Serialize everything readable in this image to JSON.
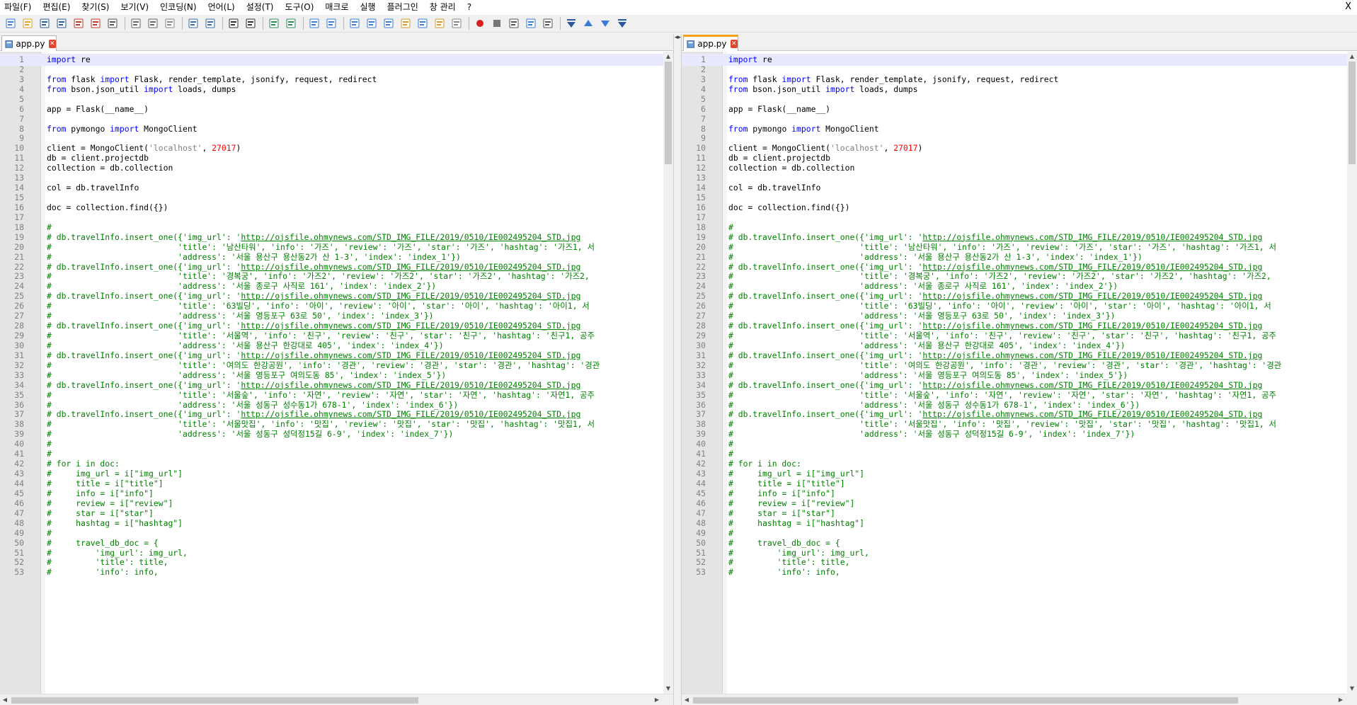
{
  "menu": {
    "items": [
      "파일(F)",
      "편집(E)",
      "찾기(S)",
      "보기(V)",
      "인코딩(N)",
      "언어(L)",
      "설정(T)",
      "도구(O)",
      "매크로",
      "실행",
      "플러그인",
      "창 관리",
      "?"
    ],
    "close_label": "X"
  },
  "toolbar": {
    "icons": [
      "new-file-icon",
      "open-file-icon",
      "save-icon",
      "save-all-icon",
      "close-icon",
      "close-all-icon",
      "print-icon",
      "cut-icon",
      "copy-icon",
      "paste-icon",
      "undo-icon",
      "redo-icon",
      "find-icon",
      "replace-icon",
      "zoom-in-icon",
      "zoom-out-icon",
      "sync-vertical-icon",
      "sync-horizontal-icon",
      "word-wrap-icon",
      "show-all-chars-icon",
      "indent-guide-icon",
      "function-list-icon",
      "doc-map-icon",
      "folder-workspace-icon",
      "monitoring-icon",
      "record-macro-icon",
      "stop-macro-icon",
      "play-macro-icon",
      "run-macro-multiple-icon",
      "save-macro-icon",
      "compare-first-icon",
      "compare-prev-icon",
      "compare-next-icon",
      "compare-last-icon"
    ]
  },
  "colors": {
    "keyword": "#0000ff",
    "comment": "#008000",
    "number": "#ff0000",
    "string": "#808080",
    "active_tab_accent": "#f8a01a"
  },
  "left_pane": {
    "tab_label": "app.py"
  },
  "right_pane": {
    "tab_label": "app.py"
  },
  "lines": [
    {
      "n": "1",
      "t": [
        [
          "kw",
          "import"
        ],
        [
          "",
          " re"
        ]
      ]
    },
    {
      "n": "2",
      "t": []
    },
    {
      "n": "3",
      "t": [
        [
          "kw",
          "from"
        ],
        [
          "",
          " flask "
        ],
        [
          "kw",
          "import"
        ],
        [
          "",
          " Flask, render_template, jsonify, request, redirect"
        ]
      ]
    },
    {
      "n": "4",
      "t": [
        [
          "kw",
          "from"
        ],
        [
          "",
          " bson.json_util "
        ],
        [
          "kw",
          "import"
        ],
        [
          "",
          " loads, dumps"
        ]
      ]
    },
    {
      "n": "5",
      "t": []
    },
    {
      "n": "6",
      "t": [
        [
          "",
          "app = Flask(__name__)"
        ]
      ]
    },
    {
      "n": "7",
      "t": []
    },
    {
      "n": "8",
      "t": [
        [
          "kw",
          "from"
        ],
        [
          "",
          " pymongo "
        ],
        [
          "kw",
          "import"
        ],
        [
          "",
          " MongoClient"
        ]
      ]
    },
    {
      "n": "9",
      "t": []
    },
    {
      "n": "10",
      "t": [
        [
          "",
          "client = MongoClient("
        ],
        [
          "str",
          "'localhost'"
        ],
        [
          "",
          ", "
        ],
        [
          "num",
          "27017"
        ],
        [
          "",
          ")"
        ]
      ]
    },
    {
      "n": "11",
      "t": [
        [
          "",
          "db = client.projectdb"
        ]
      ]
    },
    {
      "n": "12",
      "t": [
        [
          "",
          "collection = db.collection"
        ]
      ]
    },
    {
      "n": "13",
      "t": []
    },
    {
      "n": "14",
      "t": [
        [
          "",
          "col = db.travelInfo"
        ]
      ]
    },
    {
      "n": "15",
      "t": []
    },
    {
      "n": "16",
      "t": [
        [
          "",
          "doc = collection.find({})"
        ]
      ]
    },
    {
      "n": "17",
      "t": []
    },
    {
      "n": "18",
      "t": [
        [
          "cm",
          "#"
        ]
      ]
    },
    {
      "n": "19",
      "t": [
        [
          "cm",
          "# db.travelInfo.insert_one({'img_url': '"
        ],
        [
          "cm-url",
          "http://ojsfile.ohmynews.com/STD_IMG_FILE/2019/0510/IE002495204_STD.jpg"
        ]
      ]
    },
    {
      "n": "20",
      "t": [
        [
          "cm",
          "#                          'title': '남산타워', 'info': '가즈', 'review': '가즈', 'star': '가즈', 'hashtag': '가즈1, 서"
        ]
      ]
    },
    {
      "n": "21",
      "t": [
        [
          "cm",
          "#                          'address': '서울 용산구 용산동2가 산 1-3', 'index': 'index_1'})"
        ]
      ]
    },
    {
      "n": "22",
      "t": [
        [
          "cm",
          "# db.travelInfo.insert_one({'img_url': '"
        ],
        [
          "cm-url",
          "http://ojsfile.ohmynews.com/STD_IMG_FILE/2019/0510/IE002495204_STD.jpg"
        ]
      ]
    },
    {
      "n": "23",
      "t": [
        [
          "cm",
          "#                          'title': '경복궁', 'info': '가즈2', 'review': '가즈2', 'star': '가즈2', 'hashtag': '가즈2,"
        ]
      ]
    },
    {
      "n": "24",
      "t": [
        [
          "cm",
          "#                          'address': '서울 종로구 사직로 161', 'index': 'index_2'})"
        ]
      ]
    },
    {
      "n": "25",
      "t": [
        [
          "cm",
          "# db.travelInfo.insert_one({'img_url': '"
        ],
        [
          "cm-url",
          "http://ojsfile.ohmynews.com/STD_IMG_FILE/2019/0510/IE002495204_STD.jpg"
        ]
      ]
    },
    {
      "n": "26",
      "t": [
        [
          "cm",
          "#                          'title': '63빌딩', 'info': '아이', 'review': '아이', 'star': '아이', 'hashtag': '아이1, 서"
        ]
      ]
    },
    {
      "n": "27",
      "t": [
        [
          "cm",
          "#                          'address': '서울 영등포구 63로 50', 'index': 'index_3'})"
        ]
      ]
    },
    {
      "n": "28",
      "t": [
        [
          "cm",
          "# db.travelInfo.insert_one({'img_url': '"
        ],
        [
          "cm-url",
          "http://ojsfile.ohmynews.com/STD_IMG_FILE/2019/0510/IE002495204_STD.jpg"
        ]
      ]
    },
    {
      "n": "29",
      "t": [
        [
          "cm",
          "#                          'title': '서울역', 'info': '친구', 'review': '친구', 'star': '친구', 'hashtag': '친구1, 공주"
        ]
      ]
    },
    {
      "n": "30",
      "t": [
        [
          "cm",
          "#                          'address': '서울 용산구 한강대로 405', 'index': 'index_4'})"
        ]
      ]
    },
    {
      "n": "31",
      "t": [
        [
          "cm",
          "# db.travelInfo.insert_one({'img_url': '"
        ],
        [
          "cm-url",
          "http://ojsfile.ohmynews.com/STD_IMG_FILE/2019/0510/IE002495204_STD.jpg"
        ]
      ]
    },
    {
      "n": "32",
      "t": [
        [
          "cm",
          "#                          'title': '여의도 한강공원', 'info': '경관', 'review': '경관', 'star': '경관', 'hashtag': '경관"
        ]
      ]
    },
    {
      "n": "33",
      "t": [
        [
          "cm",
          "#                          'address': '서울 영등포구 여의도동 85', 'index': 'index_5'})"
        ]
      ]
    },
    {
      "n": "34",
      "t": [
        [
          "cm",
          "# db.travelInfo.insert_one({'img_url': '"
        ],
        [
          "cm-url",
          "http://ojsfile.ohmynews.com/STD_IMG_FILE/2019/0510/IE002495204_STD.jpg"
        ]
      ]
    },
    {
      "n": "35",
      "t": [
        [
          "cm",
          "#                          'title': '서울숲', 'info': '자연', 'review': '자연', 'star': '자연', 'hashtag': '자연1, 공주"
        ]
      ]
    },
    {
      "n": "36",
      "t": [
        [
          "cm",
          "#                          'address': '서울 성동구 성수동1가 678-1', 'index': 'index_6'})"
        ]
      ]
    },
    {
      "n": "37",
      "t": [
        [
          "cm",
          "# db.travelInfo.insert_one({'img_url': '"
        ],
        [
          "cm-url",
          "http://ojsfile.ohmynews.com/STD_IMG_FILE/2019/0510/IE002495204_STD.jpg"
        ]
      ]
    },
    {
      "n": "38",
      "t": [
        [
          "cm",
          "#                          'title': '서울맛집', 'info': '맛집', 'review': '맛집', 'star': '맛집', 'hashtag': '맛집1, 서"
        ]
      ]
    },
    {
      "n": "39",
      "t": [
        [
          "cm",
          "#                          'address': '서울 성동구 성덕정15길 6-9', 'index': 'index_7'})"
        ]
      ]
    },
    {
      "n": "40",
      "t": [
        [
          "cm",
          "#"
        ]
      ]
    },
    {
      "n": "41",
      "t": [
        [
          "cm",
          "#"
        ]
      ]
    },
    {
      "n": "42",
      "t": [
        [
          "cm",
          "# for i in doc:"
        ]
      ]
    },
    {
      "n": "43",
      "t": [
        [
          "cm",
          "#     img_url = i[\"img_url\"]"
        ]
      ]
    },
    {
      "n": "44",
      "t": [
        [
          "cm",
          "#     title = i[\"title\"]"
        ]
      ]
    },
    {
      "n": "45",
      "t": [
        [
          "cm",
          "#     info = i[\"info\"]"
        ]
      ]
    },
    {
      "n": "46",
      "t": [
        [
          "cm",
          "#     review = i[\"review\"]"
        ]
      ]
    },
    {
      "n": "47",
      "t": [
        [
          "cm",
          "#     star = i[\"star\"]"
        ]
      ]
    },
    {
      "n": "48",
      "t": [
        [
          "cm",
          "#     hashtag = i[\"hashtag\"]"
        ]
      ]
    },
    {
      "n": "49",
      "t": [
        [
          "cm",
          "#"
        ]
      ]
    },
    {
      "n": "50",
      "t": [
        [
          "cm",
          "#     travel_db_doc = {"
        ]
      ]
    },
    {
      "n": "51",
      "t": [
        [
          "cm",
          "#         'img_url': img_url,"
        ]
      ]
    },
    {
      "n": "52",
      "t": [
        [
          "cm",
          "#         'title': title,"
        ]
      ]
    },
    {
      "n": "53",
      "t": [
        [
          "cm",
          "#         'info': info,"
        ]
      ]
    }
  ]
}
